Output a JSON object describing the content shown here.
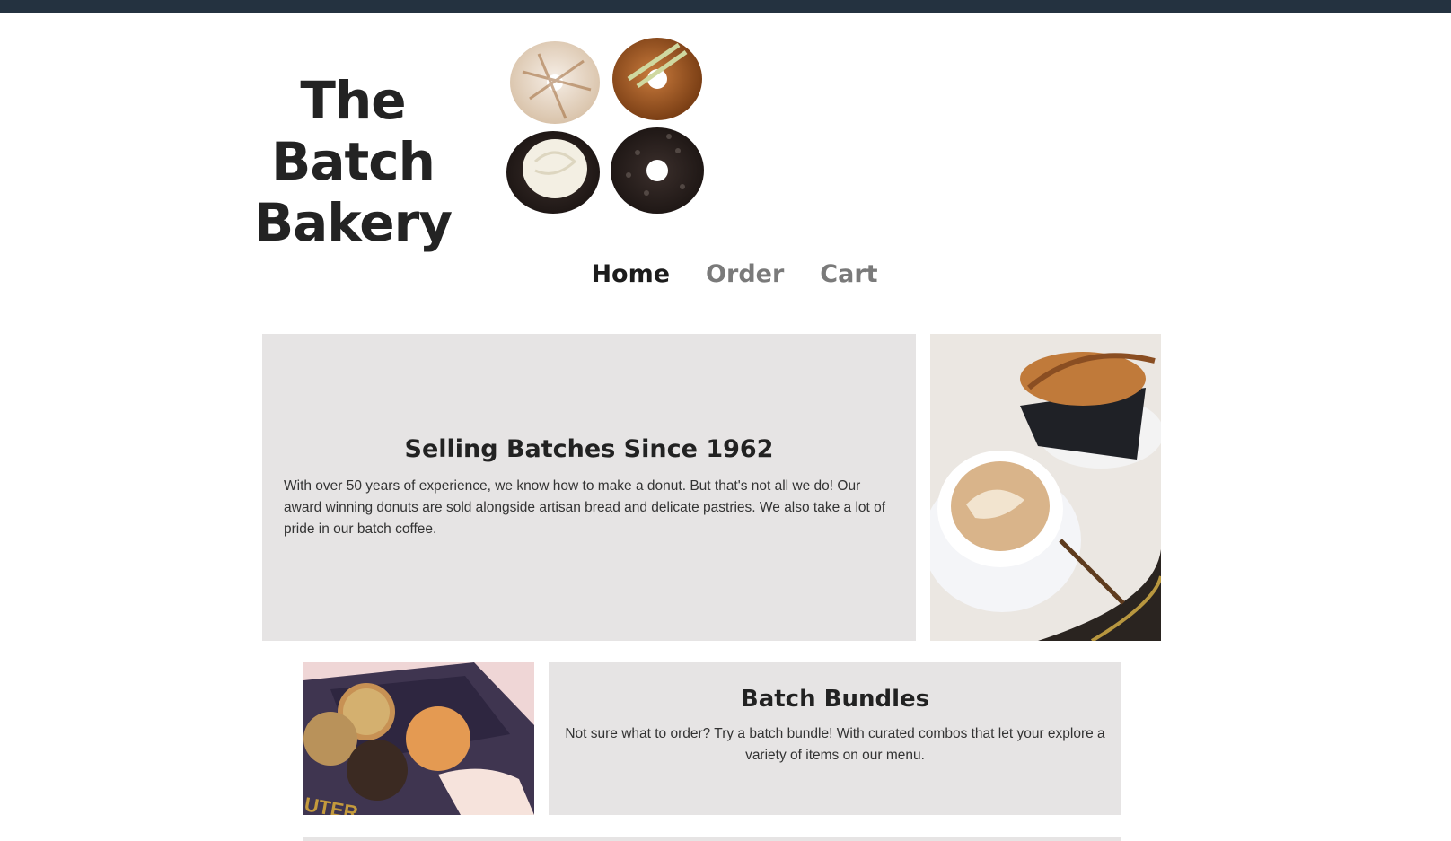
{
  "brand": {
    "line1": "The Batch",
    "line2": "Bakery"
  },
  "nav": {
    "items": [
      {
        "label": "Home",
        "active": true
      },
      {
        "label": "Order",
        "active": false
      },
      {
        "label": "Cart",
        "active": false
      }
    ]
  },
  "hero": {
    "title": "Selling Batches Since 1962",
    "body": "With over 50 years of experience, we know how to make a donut. But that's not all we do! Our award winning donuts are sold alongside artisan bread and delicate pastries. We also take a lot of pride in our batch coffee."
  },
  "bundles": {
    "title": "Batch Bundles",
    "body": "Not sure what to order? Try a batch bundle! With curated combos that let your explore a variety of items on our menu."
  },
  "colors": {
    "topbar": "#243240",
    "panel": "#e6e4e4",
    "nav_active": "#1c1c1c",
    "nav_inactive": "#7a7a7a"
  }
}
